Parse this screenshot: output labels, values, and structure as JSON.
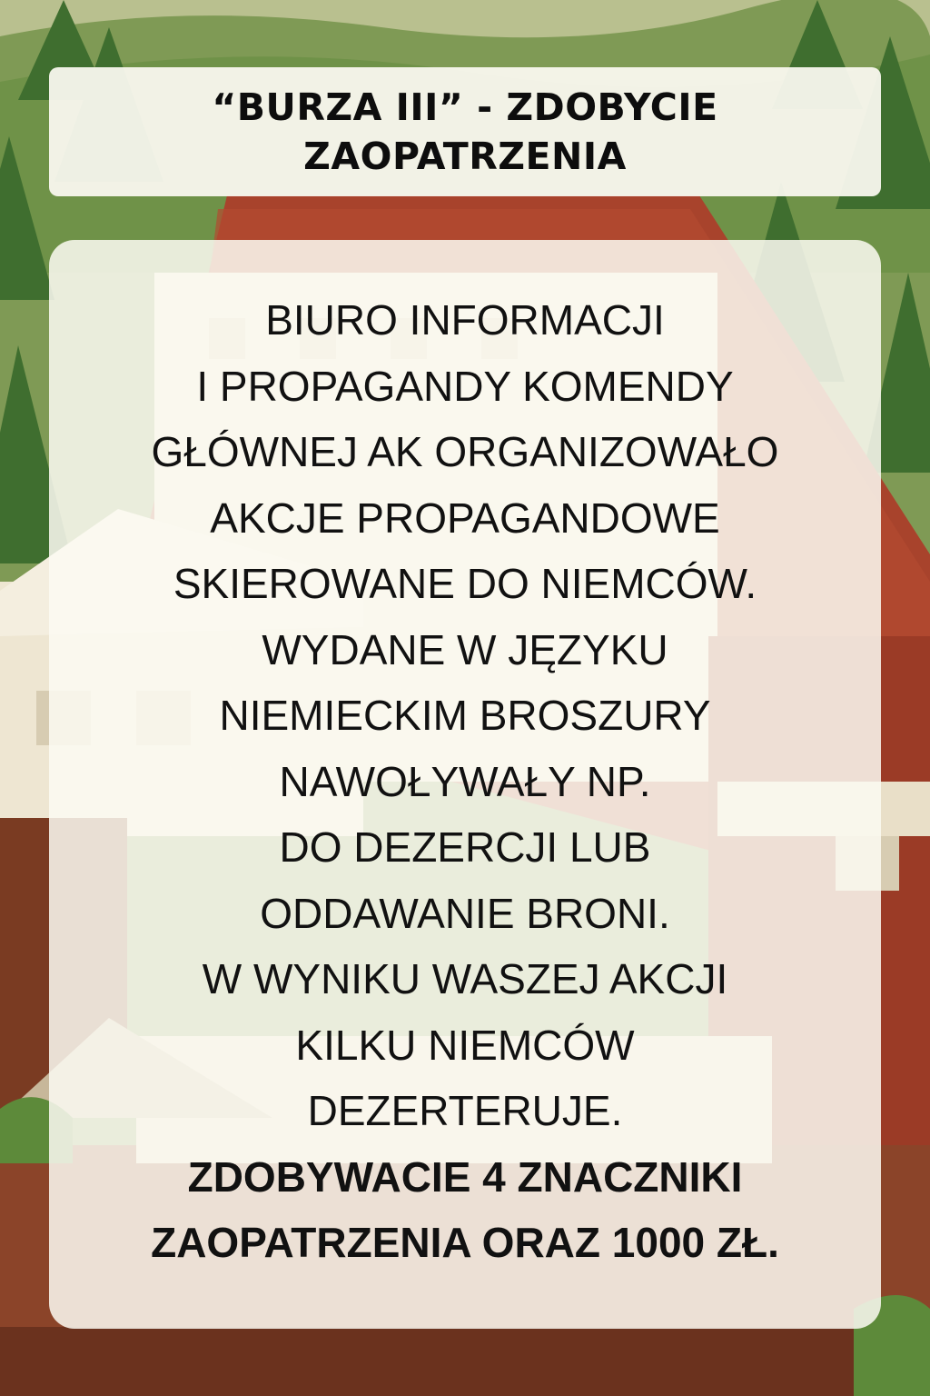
{
  "title": {
    "lines": [
      "“BURZA III” - ZDOBYCIE",
      "ZAOPATRZENIA"
    ]
  },
  "body": {
    "lines": [
      "BIURO INFORMACJI",
      "I PROPAGANDY KOMENDY",
      "GŁÓWNEJ AK ORGANIZOWAŁO",
      "AKCJE PROPAGANDOWE",
      "SKIEROWANE DO NIEMCÓW.",
      "WYDANE W JĘZYKU",
      "NIEMIECKIM BROSZURY",
      "NAWOŁYWAŁY NP.",
      "DO DEZERCJI LUB",
      "ODDAWANIE BRONI.",
      "W WYNIKU WASZEJ AKCJI",
      "KILKU NIEMCÓW",
      "DEZERTERUJE."
    ],
    "bold_lines": [
      "ZDOBYWACIE 4 ZNACZNIKI",
      "ZAOPATRZENIA ORAZ 1000 ZŁ."
    ]
  },
  "colors": {
    "forest": "#4f7a33",
    "roof": "#a8432c",
    "wall": "#f1ead6",
    "card": "#fcfaf2",
    "text": "#111111"
  }
}
